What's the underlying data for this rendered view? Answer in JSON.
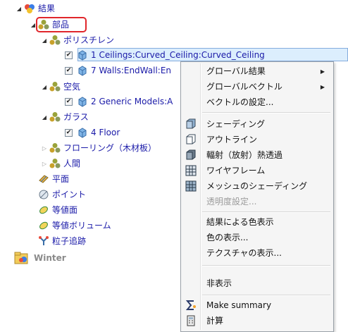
{
  "tree": {
    "results": "結果",
    "parts": "部品",
    "polystyrene": "ポリスチレン",
    "ceilings": "1 Ceilings:Curved_Ceiling:Curved_Ceiling",
    "walls": "7 Walls:EndWall:En",
    "air": "空気",
    "generic_models": "2 Generic Models:A",
    "glass": "ガラス",
    "floor": "4 Floor",
    "flooring": "フローリング（木材板）",
    "human": "人間",
    "plane": "平面",
    "point": "ポイント",
    "isosurface": "等値面",
    "isovolume": "等値ボリューム",
    "particle_trace": "粒子追跡",
    "winter": "Winter"
  },
  "menu": {
    "global_results": "グローバル結果",
    "global_vectors": "グローバルベクトル",
    "vector_settings": "ベクトルの設定...",
    "shading": "シェーディング",
    "outline": "アウトライン",
    "radiation": "輻射（放射）熱透過",
    "wireframe": "ワイヤフレーム",
    "mesh_shading": "メッシュのシェーディング",
    "transparency": "透明度設定...",
    "color_by_results": "結果による色表示",
    "show_color": "色の表示...",
    "show_texture": "テクスチャの表示...",
    "hide": "非表示",
    "make_summary": "Make summary",
    "calculate": "計算"
  }
}
